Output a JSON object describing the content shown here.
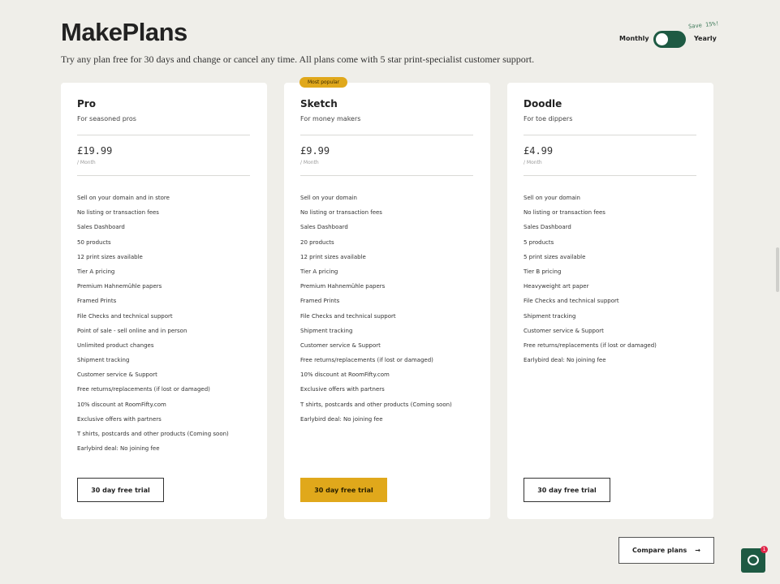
{
  "header": {
    "title": "MakePlans",
    "subtitle": "Try any plan free for 30 days and change or cancel any time. All plans come with 5 star print-specialist customer support."
  },
  "billing": {
    "monthly_label": "Monthly",
    "yearly_label": "Yearly",
    "save_note": "Save 15%!",
    "selected": "Monthly"
  },
  "plans": [
    {
      "name": "Pro",
      "tagline": "For seasoned pros",
      "price": "£19.99",
      "period": "/ Month",
      "badge": "",
      "cta": "30 day free trial",
      "features": [
        "Sell on your domain and in store",
        "No listing or transaction fees",
        "Sales Dashboard",
        "50 products",
        "12 print sizes available",
        "Tier A pricing",
        "Premium Hahnemühle papers",
        "Framed Prints",
        "File Checks and technical support",
        "Point of sale - sell online and in person",
        "Unlimited product changes",
        "Shipment tracking",
        "Customer service & Support",
        "Free returns/replacements (if lost or damaged)",
        "10% discount at RoomFifty.com",
        "Exclusive offers with partners",
        "T shirts, postcards and other products (Coming soon)",
        "Earlybird deal: No joining fee"
      ]
    },
    {
      "name": "Sketch",
      "tagline": "For money makers",
      "price": "£9.99",
      "period": "/ Month",
      "badge": "Most popular",
      "cta": "30 day free trial",
      "features": [
        "Sell on your domain",
        "No listing or transaction fees",
        "Sales Dashboard",
        "20 products",
        "12 print sizes available",
        "Tier A pricing",
        "Premium Hahnemühle papers",
        "Framed Prints",
        "File Checks and technical support",
        "Shipment tracking",
        "Customer service & Support",
        "Free returns/replacements (if lost or damaged)",
        "10% discount at RoomFifty.com",
        "Exclusive offers with partners",
        "T shirts, postcards and other products (Coming soon)",
        "Earlybird deal: No joining fee"
      ]
    },
    {
      "name": "Doodle",
      "tagline": "For toe dippers",
      "price": "£4.99",
      "period": "/ Month",
      "badge": "",
      "cta": "30 day free trial",
      "features": [
        "Sell on your domain",
        "No listing or transaction fees",
        "Sales Dashboard",
        "5 products",
        "5 print sizes available",
        "Tier B pricing",
        "Heavyweight art paper",
        "File Checks and technical support",
        "Shipment tracking",
        "Customer service & Support",
        "Free returns/replacements (if lost or damaged)",
        "Earlybird deal: No joining fee"
      ]
    }
  ],
  "footer": {
    "compare_label": "Compare plans",
    "compare_arrow": "→",
    "chat_badge_count": "1"
  },
  "colors": {
    "background": "#efeee9",
    "accent_green": "#1e5a43",
    "accent_yellow": "#e0a81b"
  }
}
